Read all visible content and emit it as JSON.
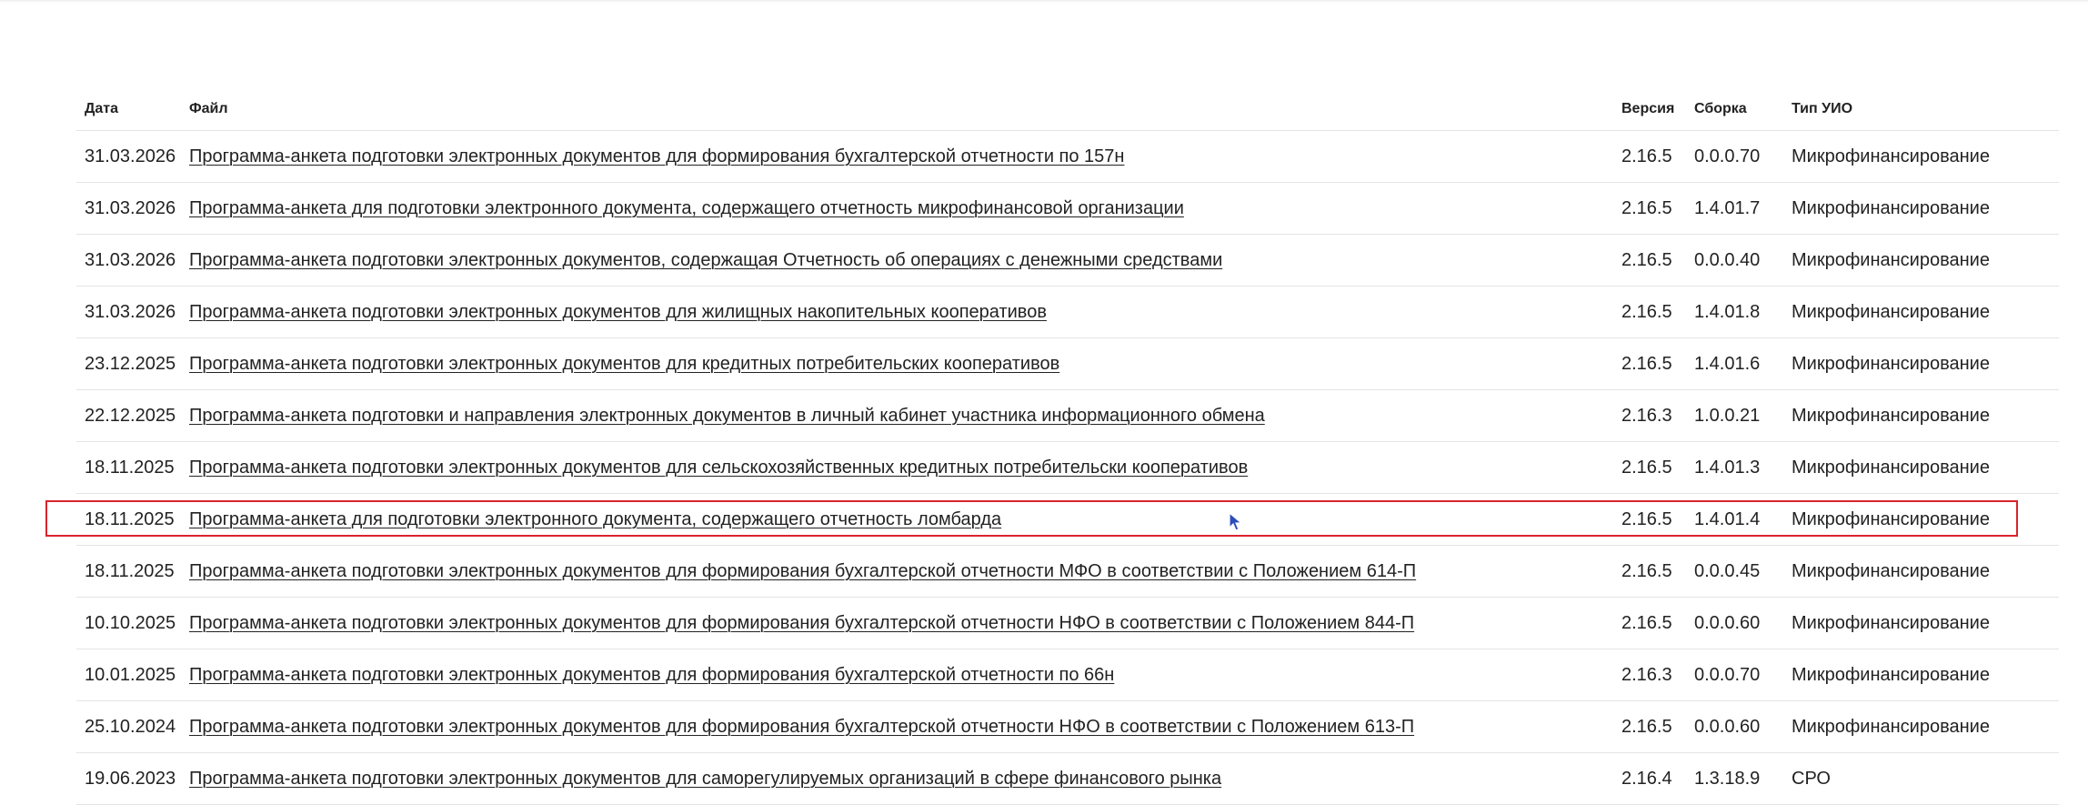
{
  "table": {
    "headers": {
      "date": "Дата",
      "file": "Файл",
      "version": "Версия",
      "build": "Сборка",
      "type": "Тип УИО"
    },
    "rows": [
      {
        "date": "31.03.2026",
        "file": "Программа-анкета подготовки электронных документов для формирования бухгалтерской отчетности по 157н",
        "version": "2.16.5",
        "build": "0.0.0.70",
        "type": "Микрофинансирование"
      },
      {
        "date": "31.03.2026",
        "file": "Программа-анкета для подготовки электронного документа, содержащего отчетность микрофинансовой организации",
        "version": "2.16.5",
        "build": "1.4.01.7",
        "type": "Микрофинансирование"
      },
      {
        "date": "31.03.2026",
        "file": "Программа-анкета подготовки электронных документов, содержащая Отчетность об операциях с денежными средствами",
        "version": "2.16.5",
        "build": "0.0.0.40",
        "type": "Микрофинансирование"
      },
      {
        "date": "31.03.2026",
        "file": "Программа-анкета подготовки электронных документов для жилищных накопительных кооперативов",
        "version": "2.16.5",
        "build": "1.4.01.8",
        "type": "Микрофинансирование"
      },
      {
        "date": "23.12.2025",
        "file": "Программа-анкета подготовки электронных документов для кредитных потребительских кооперативов",
        "version": "2.16.5",
        "build": "1.4.01.6",
        "type": "Микрофинансирование"
      },
      {
        "date": "22.12.2025",
        "file": "Программа-анкета подготовки и направления электронных документов в личный кабинет участника информационного обмена",
        "version": "2.16.3",
        "build": "1.0.0.21",
        "type": "Микрофинансирование"
      },
      {
        "date": "18.11.2025",
        "file": "Программа-анкета подготовки электронных документов для сельскохозяйственных кредитных потребительски кооперативов",
        "version": "2.16.5",
        "build": "1.4.01.3",
        "type": "Микрофинансирование"
      },
      {
        "date": "18.11.2025",
        "file": "Программа-анкета для подготовки электронного документа, содержащего отчетность ломбарда",
        "version": "2.16.5",
        "build": "1.4.01.4",
        "type": "Микрофинансирование"
      },
      {
        "date": "18.11.2025",
        "file": "Программа-анкета подготовки электронных документов для формирования бухгалтерской отчетности МФО в соответствии с Положением 614-П",
        "version": "2.16.5",
        "build": "0.0.0.45",
        "type": "Микрофинансирование"
      },
      {
        "date": "10.10.2025",
        "file": "Программа-анкета подготовки электронных документов для формирования бухгалтерской отчетности НФО в соответствии с Положением 844-П",
        "version": "2.16.5",
        "build": "0.0.0.60",
        "type": "Микрофинансирование"
      },
      {
        "date": "10.01.2025",
        "file": "Программа-анкета подготовки электронных документов для формирования бухгалтерской отчетности по 66н",
        "version": "2.16.3",
        "build": "0.0.0.70",
        "type": "Микрофинансирование"
      },
      {
        "date": "25.10.2024",
        "file": "Программа-анкета подготовки электронных документов для формирования бухгалтерской отчетности НФО в соответствии с Положением 613-П",
        "version": "2.16.5",
        "build": "0.0.0.60",
        "type": "Микрофинансирование"
      },
      {
        "date": "19.06.2023",
        "file": "Программа-анкета подготовки электронных документов для саморегулируемых организаций в сфере финансового рынка",
        "version": "2.16.4",
        "build": "1.3.18.9",
        "type": "СРО"
      }
    ]
  },
  "highlight": {
    "color": "#d9232d"
  },
  "cursor": {
    "icon": "arrow-cursor-icon",
    "color": "#2a4fb8"
  }
}
